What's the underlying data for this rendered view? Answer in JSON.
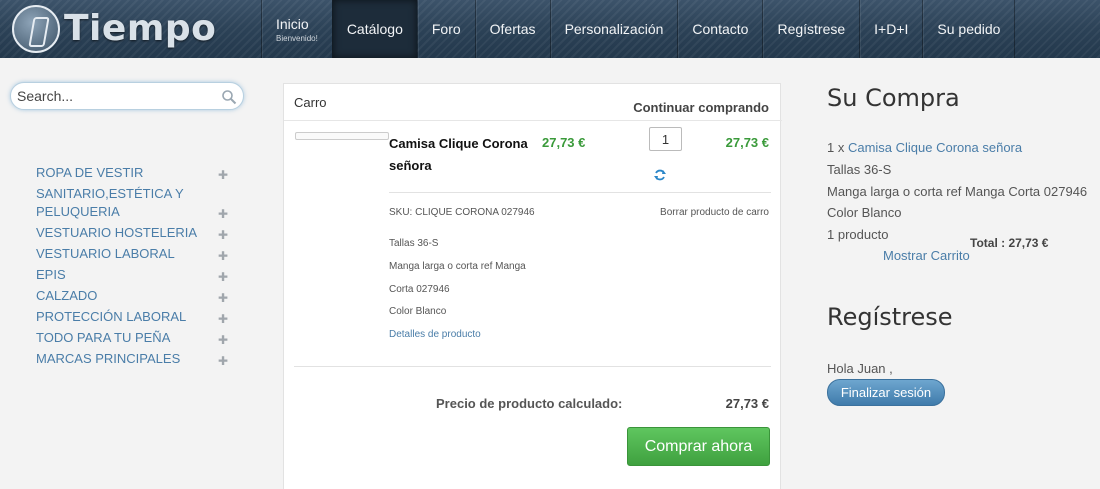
{
  "brand": {
    "name": "Tiempo"
  },
  "nav": {
    "items": [
      {
        "label": "Inicio",
        "sub": "Bienvenido!"
      },
      {
        "label": "Catálogo"
      },
      {
        "label": "Foro"
      },
      {
        "label": "Ofertas"
      },
      {
        "label": "Personalización"
      },
      {
        "label": "Contacto"
      },
      {
        "label": "Regístrese"
      },
      {
        "label": "I+D+I"
      },
      {
        "label": "Su pedido"
      }
    ],
    "active": "Catálogo"
  },
  "search": {
    "placeholder": "Search..."
  },
  "sidebar": {
    "items": [
      {
        "label": "ROPA DE VESTIR"
      },
      {
        "label": "SANITARIO,ESTÉTICA Y PELUQUERIA"
      },
      {
        "label": "VESTUARIO HOSTELERIA"
      },
      {
        "label": "VESTUARIO LABORAL"
      },
      {
        "label": "EPIS"
      },
      {
        "label": "CALZADO"
      },
      {
        "label": "PROTECCIÓN LABORAL"
      },
      {
        "label": "TODO PARA TU PEÑA"
      },
      {
        "label": "MARCAS PRINCIPALES"
      }
    ]
  },
  "cart": {
    "title": "Carro",
    "continue_label": "Continuar comprando",
    "item": {
      "name": "Camisa Clique Corona señora",
      "unit_price": "27,73 €",
      "quantity": "1",
      "line_total": "27,73 €",
      "sku": "SKU: CLIQUE CORONA 027946",
      "remove_label": "Borrar producto de carro",
      "details": [
        "Tallas 36-S",
        "Manga larga o corta ref Manga",
        "Corta 027946",
        "Color Blanco"
      ],
      "details_link": "Detalles de producto"
    },
    "calculated_label": "Precio de producto calculado:",
    "calculated_value": "27,73 €",
    "buy_label": "Comprar ahora"
  },
  "purchase": {
    "title": "Su Compra",
    "qty_prefix": "1 x",
    "product_link": "Camisa Clique Corona señora",
    "lines": [
      "Tallas 36-S",
      "Manga larga o corta ref Manga Corta 027946",
      "Color Blanco"
    ],
    "count": "1 producto",
    "total": "Total : 27,73 €",
    "show_cart": "Mostrar Carrito"
  },
  "register": {
    "title": "Regístrese",
    "greeting": "Hola Juan ,",
    "logout_label": "Finalizar sesión"
  },
  "colors": {
    "header": "#2c4257",
    "link": "#4a7da8",
    "price": "#3a9a3a",
    "buy_button": "#4cb34c",
    "logout_button": "#4f8bba"
  },
  "icons": [
    "search-icon",
    "plus-icon",
    "refresh-icon",
    "logo-icon"
  ]
}
